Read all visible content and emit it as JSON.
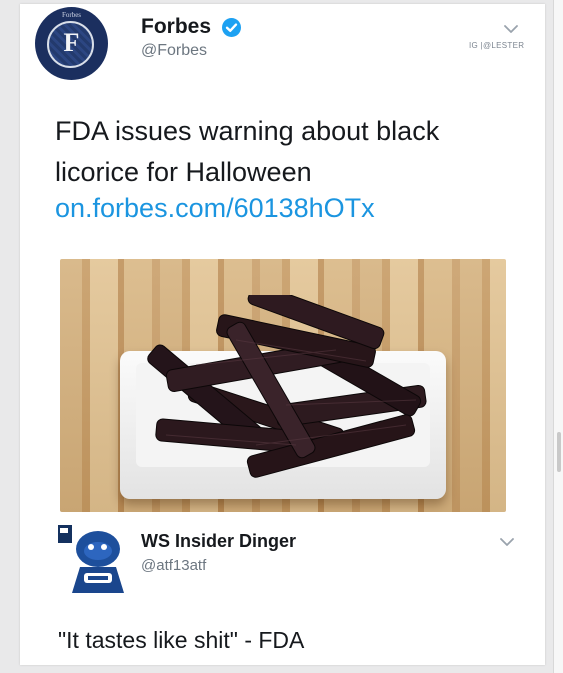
{
  "tweet": {
    "author_name": "Forbes",
    "author_handle": "@Forbes",
    "avatar_letter": "F",
    "avatar_top_text": "Forbes",
    "text": "FDA issues warning about black licorice for Halloween",
    "link": "on.forbes.com/60138hOTx",
    "image_alt": "black licorice twists on a white plate on a wooden surface",
    "icons": {
      "verified": "verified-badge-icon",
      "menu": "chevron-down-icon"
    },
    "colors": {
      "verified": "#1da1f2",
      "link": "#1b95e0",
      "avatar_bg": "#1b2f5f"
    }
  },
  "watermark": "IG |@LESTER",
  "reply": {
    "author_name": "WS Insider Dinger",
    "author_handle": "@atf13atf",
    "text": "\"It tastes like shit\" - FDA",
    "avatar": "dodgers-mascot-avatar",
    "icons": {
      "menu": "chevron-down-icon"
    }
  }
}
